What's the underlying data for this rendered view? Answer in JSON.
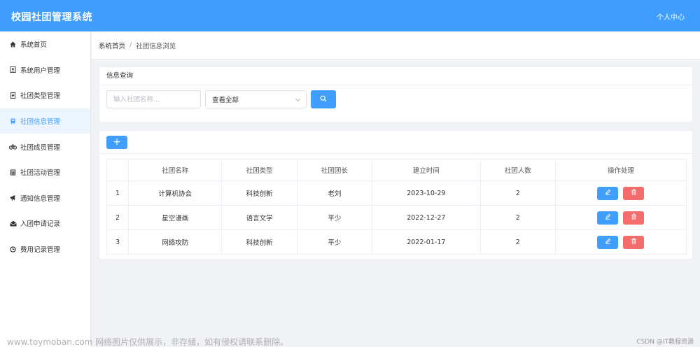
{
  "app": {
    "title": "校园社团管理系统",
    "user_center": "个人中心"
  },
  "sidebar": {
    "items": [
      {
        "label": "系统首页",
        "icon": "home-icon"
      },
      {
        "label": "系统用户管理",
        "icon": "user-card-icon"
      },
      {
        "label": "社团类型管理",
        "icon": "document-icon"
      },
      {
        "label": "社团信息管理",
        "icon": "train-icon",
        "active": true
      },
      {
        "label": "社团成员管理",
        "icon": "bicycle-icon"
      },
      {
        "label": "社团活动管理",
        "icon": "calculator-icon"
      },
      {
        "label": "通知信息管理",
        "icon": "megaphone-icon"
      },
      {
        "label": "入团申请记录",
        "icon": "envelope-icon"
      },
      {
        "label": "费用记录管理",
        "icon": "clock-icon"
      }
    ]
  },
  "breadcrumb": {
    "home": "系统首页",
    "separator": "/",
    "current": "社团信息浏览"
  },
  "search": {
    "title": "信息查询",
    "input_placeholder": "输入社团名称...",
    "input_value": "",
    "select_value": "查看全部"
  },
  "table": {
    "add_label": "+",
    "headers": [
      "",
      "社团名称",
      "社团类型",
      "社团团长",
      "建立时间",
      "社团人数",
      "操作处理"
    ],
    "rows": [
      {
        "index": "1",
        "name": "计算机协会",
        "type": "科技创新",
        "leader": "老刘",
        "created": "2023-10-29",
        "members": "2"
      },
      {
        "index": "2",
        "name": "星空漫画",
        "type": "语言文学",
        "leader": "平少",
        "created": "2022-12-27",
        "members": "2"
      },
      {
        "index": "3",
        "name": "网络攻防",
        "type": "科技创新",
        "leader": "平少",
        "created": "2022-01-17",
        "members": "2"
      }
    ]
  },
  "watermark": {
    "text": "www.toymoban.com 网络图片仅供展示，非存储，如有侵权请联系删除。",
    "credit": "CSDN @IT教程资源"
  },
  "colors": {
    "primary": "#409eff",
    "danger": "#f56c6c",
    "background": "#f0f2f5"
  }
}
